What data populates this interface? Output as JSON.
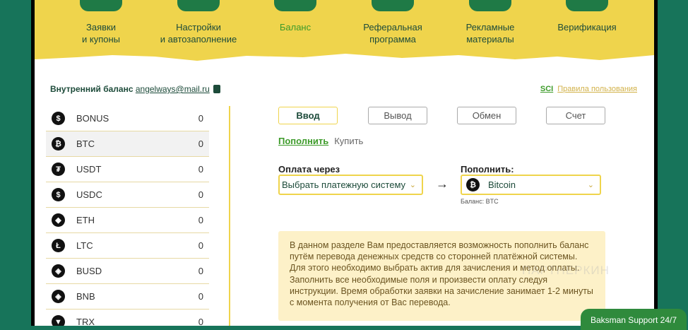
{
  "nav": [
    {
      "label1": "Заявки",
      "label2": "и купоны"
    },
    {
      "label1": "Настройки",
      "label2": "и автозаполнение"
    },
    {
      "label1": "Баланс",
      "label2": ""
    },
    {
      "label1": "Реферальная",
      "label2": "программа"
    },
    {
      "label1": "Рекламные",
      "label2": "материалы"
    },
    {
      "label1": "Верификация",
      "label2": ""
    }
  ],
  "balance": {
    "title": "Внутренний баланс",
    "email": "angelways@mail.ru"
  },
  "links": {
    "sci": "SCI",
    "rules": "Правила пользования"
  },
  "assets": [
    {
      "name": "BONUS",
      "value": "0",
      "icon": "$"
    },
    {
      "name": "BTC",
      "value": "0",
      "icon": "₿"
    },
    {
      "name": "USDT",
      "value": "0",
      "icon": "₮"
    },
    {
      "name": "USDC",
      "value": "0",
      "icon": "$"
    },
    {
      "name": "ETH",
      "value": "0",
      "icon": "◆"
    },
    {
      "name": "LTC",
      "value": "0",
      "icon": "Ł"
    },
    {
      "name": "BUSD",
      "value": "0",
      "icon": "◈"
    },
    {
      "name": "BNB",
      "value": "0",
      "icon": "◈"
    },
    {
      "name": "TRX",
      "value": "0",
      "icon": "▼"
    }
  ],
  "tabs": [
    "Ввод",
    "Вывод",
    "Обмен",
    "Счет"
  ],
  "subtabs": [
    "Пополнить",
    "Купить"
  ],
  "form": {
    "pay_label": "Оплата через",
    "pay_value": "Выбрать платежную систему",
    "topup_label": "Пополнить:",
    "topup_value": "Bitcoin",
    "balance_note": "Баланс: BTC"
  },
  "info": "В данном разделе Вам предоставляется возможность пополнить баланс путём перевода денежных средств со сторонней платёжной системы. Для этого необходимо выбрать актив для зачисления и метод оплаты. Заполнить все необходимые поля и произвести оплату следуя инструкции. Время обработки заявки на зачисление занимает 1-2 минуты с момента получения от Вас перевода.",
  "watermark": "ПАРТНЕРКИН",
  "support": "Baksman Support 24/7"
}
